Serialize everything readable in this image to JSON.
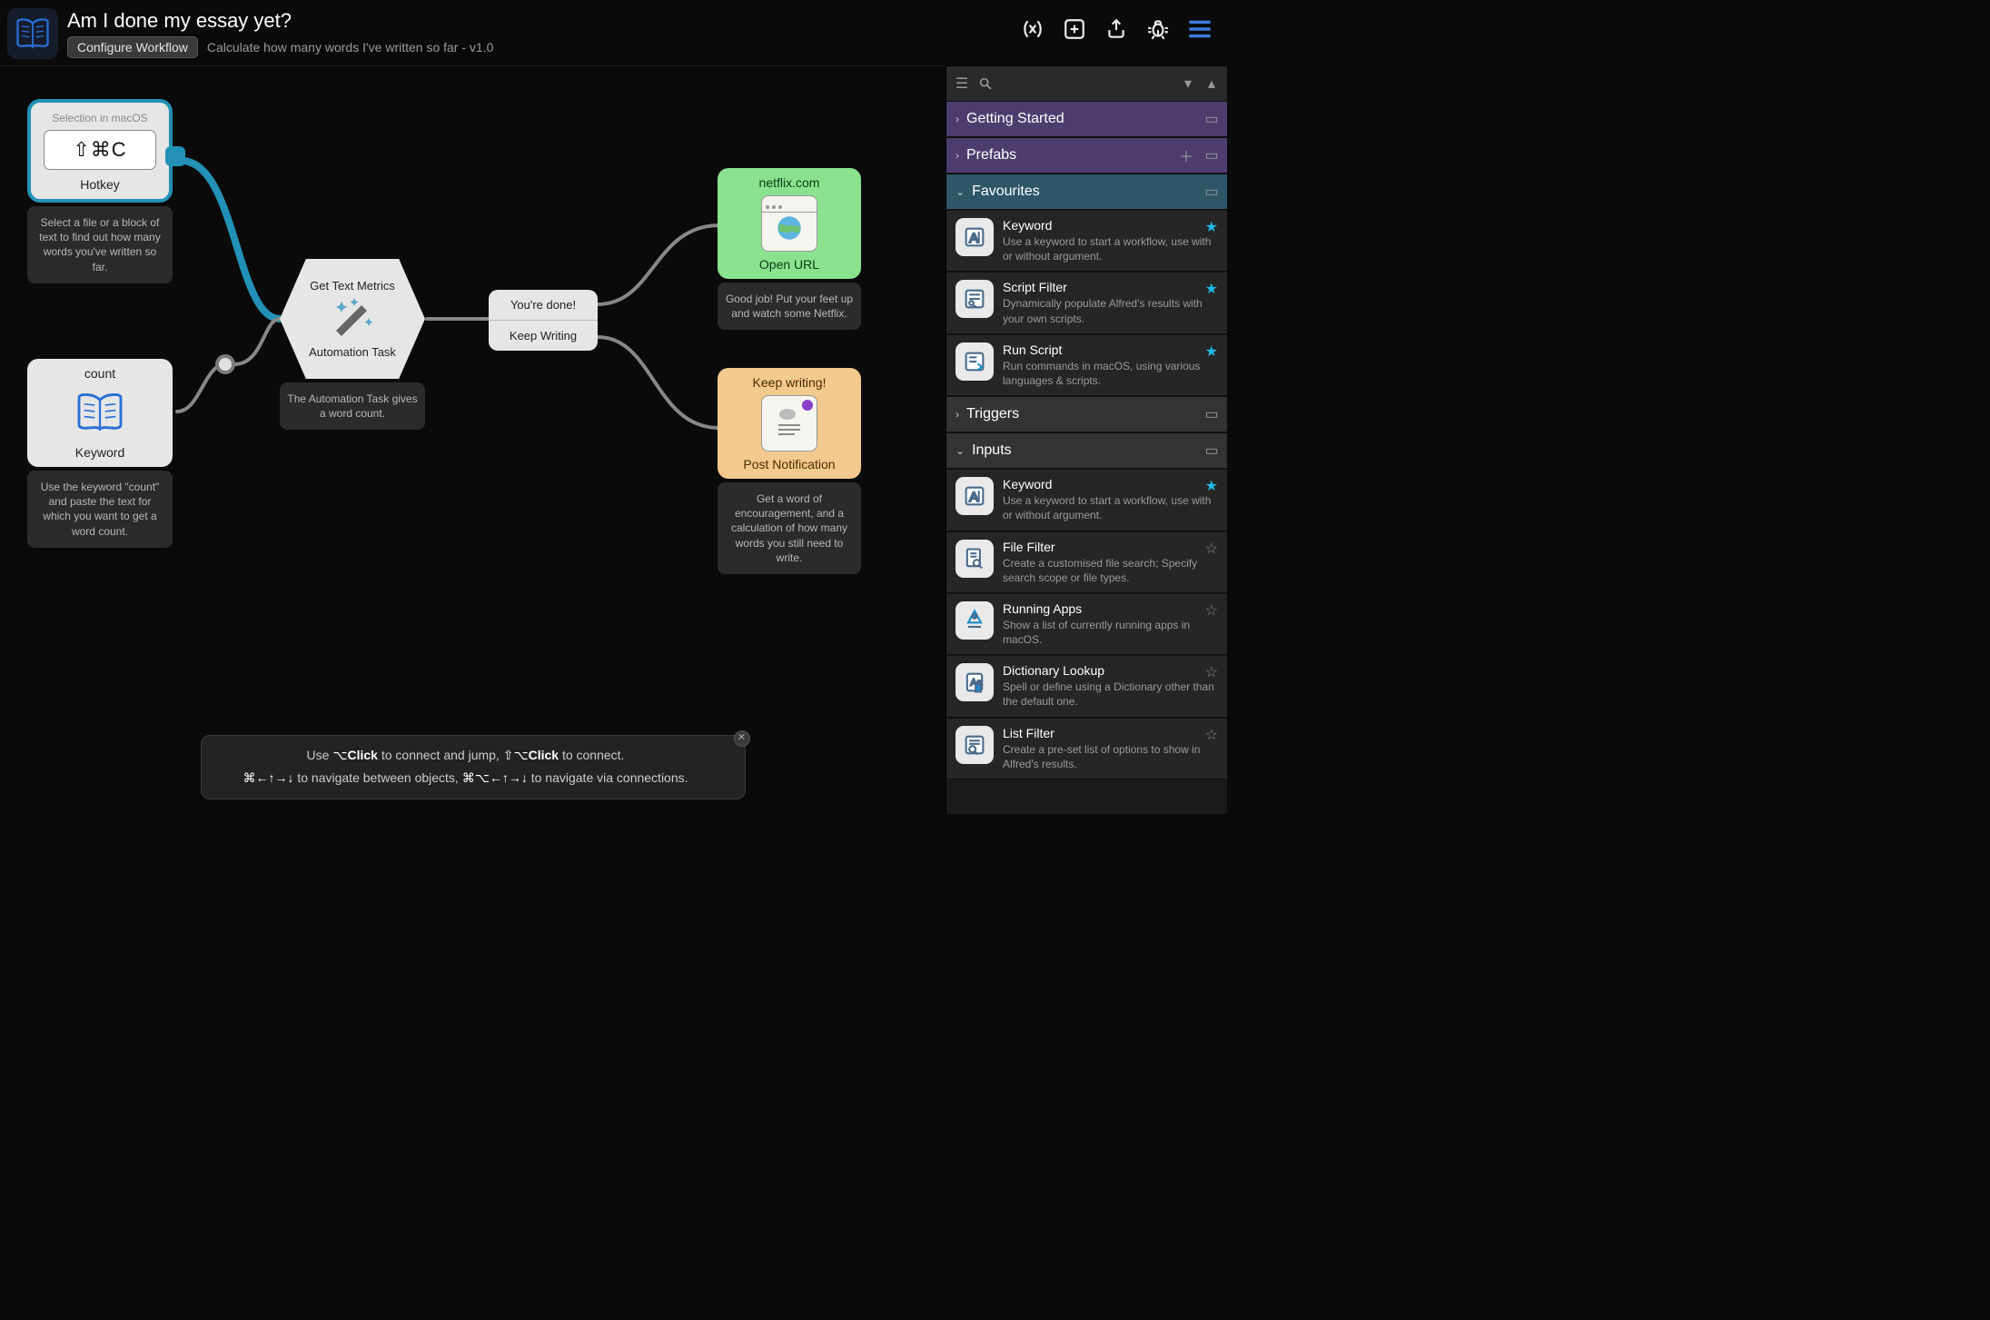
{
  "header": {
    "title": "Am I done my essay yet?",
    "configure_button": "Configure Workflow",
    "subtitle": "Calculate how many words I've written so far - v1.0"
  },
  "toolbar_icons": [
    "variables",
    "add-node",
    "export",
    "debug",
    "menu"
  ],
  "nodes": {
    "hotkey": {
      "selection": "Selection in macOS",
      "shortcut": "⇧⌘C",
      "label": "Hotkey",
      "desc": "Select a file or a block of text to find out how many words you've written so far."
    },
    "keyword": {
      "keyword": "count",
      "label": "Keyword",
      "desc": "Use the keyword \"count\" and paste the text for which you want to get a word count."
    },
    "task": {
      "title": "Get Text Metrics",
      "label": "Automation Task",
      "desc": "The Automation Task gives a word count."
    },
    "decision": {
      "done": "You're done!",
      "keep": "Keep Writing"
    },
    "openurl": {
      "url": "netflix.com",
      "label": "Open URL",
      "desc": "Good job! Put your feet up and watch some Netflix."
    },
    "notify": {
      "title": "Keep writing!",
      "label": "Post Notification",
      "desc": "Get a word of encouragement, and a calculation of how many words you still need to write."
    }
  },
  "sidebar": {
    "sections": {
      "getting_started": "Getting Started",
      "prefabs": "Prefabs",
      "favourites": "Favourites",
      "triggers": "Triggers",
      "inputs": "Inputs"
    },
    "favourites": [
      {
        "title": "Keyword",
        "desc": "Use a keyword to start a workflow, use with or without argument.",
        "fav": true,
        "icon": "keyword"
      },
      {
        "title": "Script Filter",
        "desc": "Dynamically populate Alfred's results with your own scripts.",
        "fav": true,
        "icon": "scriptfilter"
      },
      {
        "title": "Run Script",
        "desc": "Run commands in macOS, using various languages & scripts.",
        "fav": true,
        "icon": "runscript"
      }
    ],
    "inputs": [
      {
        "title": "Keyword",
        "desc": "Use a keyword to start a workflow, use with or without argument.",
        "fav": true,
        "icon": "keyword"
      },
      {
        "title": "File Filter",
        "desc": "Create a customised file search; Specify search scope or file types.",
        "fav": false,
        "icon": "filefilter"
      },
      {
        "title": "Running Apps",
        "desc": "Show a list of currently running apps in macOS.",
        "fav": false,
        "icon": "apps"
      },
      {
        "title": "Dictionary Lookup",
        "desc": "Spell or define using a Dictionary other than the default one.",
        "fav": false,
        "icon": "dict"
      },
      {
        "title": "List Filter",
        "desc": "Create a pre-set list of options to show in Alfred's results.",
        "fav": false,
        "icon": "listfilter"
      }
    ]
  },
  "help": {
    "line1_pre": "Use ",
    "line1_k1": "⌥Click",
    "line1_mid": " to connect and jump, ",
    "line1_k2": "⇧⌥Click",
    "line1_post": " to connect.",
    "line2_k1": "⌘←↑→↓",
    "line2_mid": " to navigate between objects, ",
    "line2_k2": "⌘⌥←↑→↓",
    "line2_post": " to navigate via connections."
  }
}
